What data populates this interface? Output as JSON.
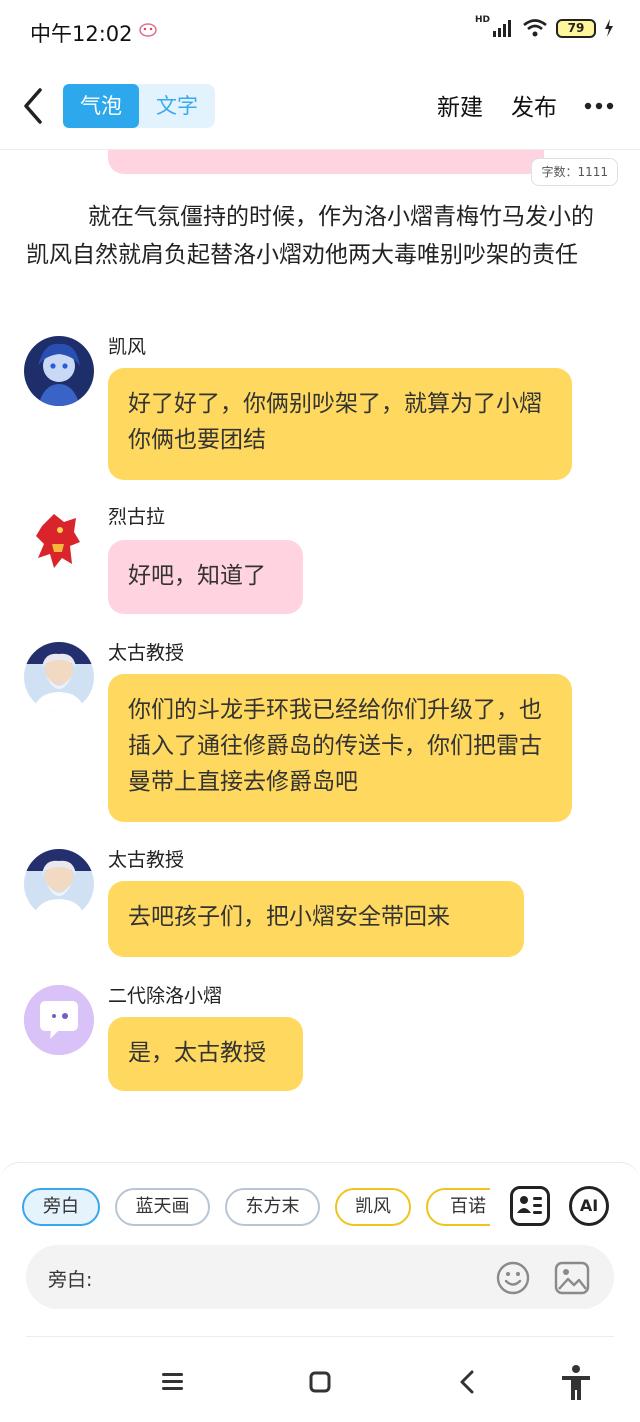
{
  "status_bar": {
    "time": "中午12:02",
    "network": "HD",
    "battery": "79"
  },
  "nav": {
    "tabs": [
      {
        "label": "气泡"
      },
      {
        "label": "文字"
      }
    ],
    "new_label": "新建",
    "publish_label": "发布"
  },
  "word_count": "字数：1111",
  "narration": "就在气氛僵持的时候，作为洛小熠青梅竹马发小的凯风自然就肩负起替洛小熠劝他两大毒唯别吵架的责任",
  "messages": [
    {
      "name": "凯风",
      "text": "好了好了，你俩别吵架了，就算为了小熠你俩也要团结",
      "color": "#ffd95f"
    },
    {
      "name": "烈古拉",
      "text": "好吧，知道了",
      "color": "#ffd3df"
    },
    {
      "name": "太古教授",
      "text": "你们的斗龙手环我已经给你们升级了，也插入了通往修爵岛的传送卡，你们把雷古曼带上直接去修爵岛吧",
      "color": "#ffd95f"
    },
    {
      "name": "太古教授",
      "text": "去吧孩子们，把小熠安全带回来",
      "color": "#ffd95f"
    },
    {
      "name": "二代除洛小熠",
      "text": "是，太古教授",
      "color": "#ffd95f"
    }
  ],
  "role_chips": [
    {
      "label": "旁白"
    },
    {
      "label": "蓝天画"
    },
    {
      "label": "东方末"
    },
    {
      "label": "凯风"
    },
    {
      "label": "百诺"
    }
  ],
  "ai_label": "AI",
  "input": {
    "speaker_label": "旁白:"
  },
  "colors": {
    "accent_blue": "#2da8ec",
    "bubble_yellow": "#ffd95f",
    "bubble_pink": "#ffd3df"
  }
}
